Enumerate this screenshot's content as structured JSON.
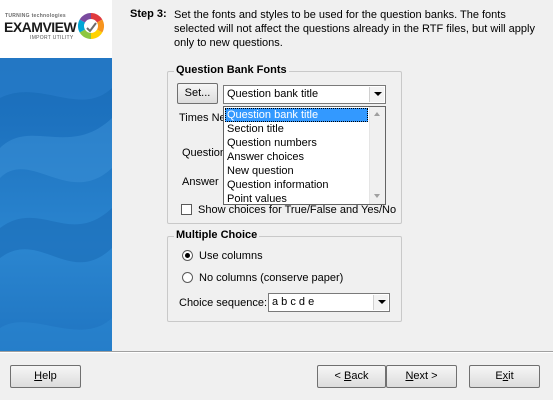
{
  "logo": {
    "company": "TURNING technologies",
    "product": "EXAMVIEW",
    "subtitle": "IMPORT UTILITY"
  },
  "step": {
    "label": "Step 3:",
    "text": "Set the fonts and styles to be used for the question banks.  The fonts selected will not affect the questions already in the RTF files, but will apply only to new questions."
  },
  "fonts_group": {
    "title": "Question Bank Fonts",
    "set_button": "Set...",
    "selected_style": "Question bank title",
    "font_name_partial": "Times Ne",
    "dropdown_options": [
      "Question bank title",
      "Section title",
      "Question numbers",
      "Answer choices",
      "New question",
      "Question information",
      "Point values"
    ],
    "hidden_label_1": "Question",
    "hidden_label_2": "Answer",
    "show_choices_checkbox": "Show choices for True/False and Yes/No",
    "show_choices_checked": false
  },
  "multiple_choice": {
    "title": "Multiple Choice",
    "use_columns": "Use columns",
    "no_columns": "No columns (conserve paper)",
    "selected_option": "use_columns",
    "sequence_label": "Choice sequence:",
    "sequence_value": "a b c d e"
  },
  "footer": {
    "help_prefix": "",
    "help_u": "H",
    "help_rest": "elp",
    "back_prefix": "< ",
    "back_u": "B",
    "back_rest": "ack",
    "next_prefix": "",
    "next_u": "N",
    "next_rest": "ext >",
    "exit_prefix": "E",
    "exit_u": "x",
    "exit_rest": "it"
  }
}
